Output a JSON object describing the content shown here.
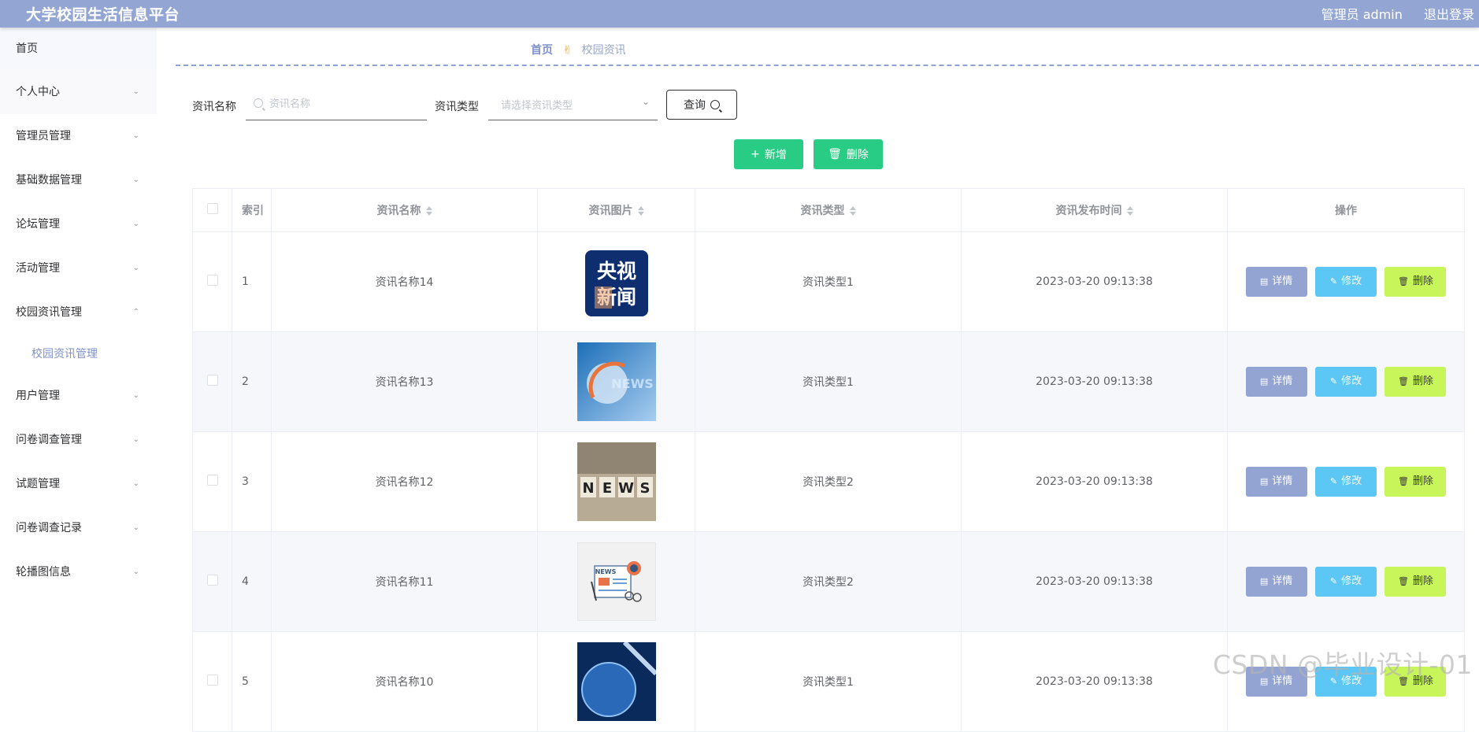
{
  "header": {
    "title": "大学校园生活信息平台",
    "admin_label": "管理员 admin",
    "logout_label": "退出登录"
  },
  "sidebar": {
    "items": [
      {
        "label": "首页"
      },
      {
        "label": "个人中心"
      },
      {
        "label": "管理员管理"
      },
      {
        "label": "基础数据管理"
      },
      {
        "label": "论坛管理"
      },
      {
        "label": "活动管理"
      },
      {
        "label": "校园资讯管理",
        "sub": "校园资讯管理"
      },
      {
        "label": "用户管理"
      },
      {
        "label": "问卷调查管理"
      },
      {
        "label": "试题管理"
      },
      {
        "label": "问卷调查记录"
      },
      {
        "label": "轮播图信息"
      }
    ]
  },
  "breadcrumb": {
    "home": "首页",
    "current": "校园资讯"
  },
  "search": {
    "name_label": "资讯名称",
    "name_placeholder": "资讯名称",
    "type_label": "资讯类型",
    "type_placeholder": "请选择资讯类型",
    "query_label": "查询"
  },
  "actions": {
    "add_label": "新增",
    "delete_label": "删除"
  },
  "table": {
    "headers": {
      "index": "索引",
      "name": "资讯名称",
      "image": "资讯图片",
      "type": "资讯类型",
      "time": "资讯发布时间",
      "ops": "操作"
    },
    "op_labels": {
      "detail": "详情",
      "edit": "修改",
      "delete": "删除"
    },
    "rows": [
      {
        "index": "1",
        "name": "资讯名称14",
        "type": "资讯类型1",
        "time": "2023-03-20 09:13:38",
        "image_text": "央视\n新闻"
      },
      {
        "index": "2",
        "name": "资讯名称13",
        "type": "资讯类型1",
        "time": "2023-03-20 09:13:38",
        "image_text": "NEWS"
      },
      {
        "index": "3",
        "name": "资讯名称12",
        "type": "资讯类型2",
        "time": "2023-03-20 09:13:38",
        "image_text": "NEWS"
      },
      {
        "index": "4",
        "name": "资讯名称11",
        "type": "资讯类型2",
        "time": "2023-03-20 09:13:38",
        "image_text": "NEWS"
      },
      {
        "index": "5",
        "name": "资讯名称10",
        "type": "资讯类型1",
        "time": "2023-03-20 09:13:38",
        "image_text": ""
      }
    ]
  },
  "watermark": "CSDN @毕业设计-01",
  "colors": {
    "header": "#93a6d3",
    "accent_green": "#29cc84",
    "detail_btn": "#93a4d2",
    "edit_btn": "#5cc6f5",
    "delete_btn": "#c8f55a"
  }
}
